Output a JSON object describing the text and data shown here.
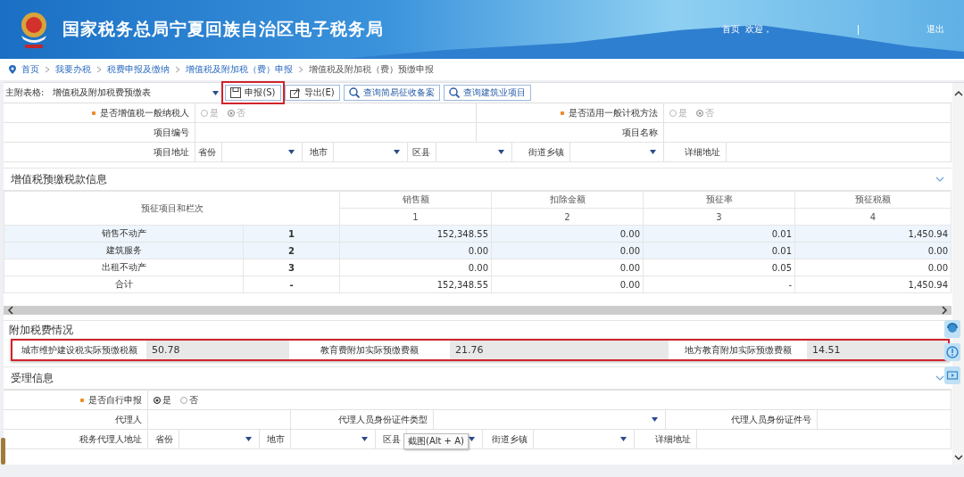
{
  "header": {
    "title": "国家税务总局宁夏回族自治区电子税务局",
    "home": "首页",
    "greeting": "欢迎，",
    "logout": "退出"
  },
  "breadcrumb": [
    {
      "label": "首页",
      "current": false
    },
    {
      "label": "我要办税",
      "current": false
    },
    {
      "label": "税费申报及缴纳",
      "current": false
    },
    {
      "label": "增值税及附加税（费）申报",
      "current": false
    },
    {
      "label": "增值税及附加税（费）预缴申报",
      "current": true
    }
  ],
  "toolbar": {
    "label": "主附表格:",
    "table_select": "增值税及附加税费预缴表",
    "buttons": [
      {
        "label": "申报(S)",
        "kind": "submit",
        "highlighted": true
      },
      {
        "label": "导出(E)",
        "kind": "export",
        "highlighted": false
      },
      {
        "label": "查询简易征收备案",
        "kind": "query",
        "highlighted": false
      },
      {
        "label": "查询建筑业项目",
        "kind": "query",
        "highlighted": false
      }
    ]
  },
  "project_form": {
    "taxpayer_row": {
      "kind": "pair",
      "cells": [
        {
          "kind": "label",
          "text": "是否增值税一般纳税人",
          "required": true
        },
        {
          "kind": "radio",
          "disabled": true,
          "options": [
            {
              "label": "是",
              "selected": false
            },
            {
              "label": "否",
              "selected": true
            }
          ]
        },
        {
          "kind": "label",
          "text": "是否适用一般计税方法",
          "required": true
        },
        {
          "kind": "radio",
          "disabled": true,
          "options": [
            {
              "label": "是",
              "selected": false
            },
            {
              "label": "否",
              "selected": true
            }
          ]
        }
      ]
    },
    "project_row": {
      "kind": "pair",
      "cells": [
        {
          "kind": "label",
          "text": "项目编号",
          "required": false
        },
        {
          "kind": "field"
        },
        {
          "kind": "label",
          "text": "项目名称",
          "required": false
        },
        {
          "kind": "field"
        }
      ]
    },
    "address_row": {
      "kind": "address",
      "cells": [
        {
          "kind": "label",
          "text": "项目地址",
          "required": false
        },
        {
          "kind": "label",
          "text": "省份",
          "required": false
        },
        {
          "kind": "select"
        },
        {
          "kind": "label",
          "text": "地市",
          "required": false
        },
        {
          "kind": "select"
        },
        {
          "kind": "label",
          "text": "区县",
          "required": false
        },
        {
          "kind": "select"
        },
        {
          "kind": "label",
          "text": "街道乡镇",
          "required": false
        },
        {
          "kind": "select"
        },
        {
          "kind": "label",
          "text": "详细地址",
          "required": false
        },
        {
          "kind": "field"
        }
      ]
    }
  },
  "prepayment": {
    "title": "增值税预缴税款信息",
    "item_header": "预征项目和栏次",
    "columns": [
      {
        "label": "销售额",
        "number": "1"
      },
      {
        "label": "扣除金额",
        "number": "2"
      },
      {
        "label": "预征率",
        "number": "3"
      },
      {
        "label": "预征税额",
        "number": "4"
      }
    ],
    "rows": [
      {
        "item": "销售不动产",
        "line": "1",
        "values": [
          "152,348.55",
          "0.00",
          "0.01",
          "1,450.94"
        ],
        "highlighted": true
      },
      {
        "item": "建筑服务",
        "line": "2",
        "values": [
          "0.00",
          "0.00",
          "0.01",
          "0.00"
        ],
        "highlighted": true
      },
      {
        "item": "出租不动产",
        "line": "3",
        "values": [
          "0.00",
          "0.00",
          "0.05",
          "0.00"
        ],
        "highlighted": false
      },
      {
        "item": "合计",
        "line": "-",
        "values": [
          "152,348.55",
          "0.00",
          "-",
          "1,450.94"
        ],
        "highlighted": false
      }
    ]
  },
  "surcharge": {
    "title": "附加税费情况",
    "highlighted": true,
    "fields": [
      {
        "label": "城市维护建设税实际预缴税额",
        "value": "50.78"
      },
      {
        "label": "教育费附加实际预缴费额",
        "value": "21.76"
      },
      {
        "label": "地方教育附加实际预缴费额",
        "value": "14.51"
      }
    ]
  },
  "acceptance": {
    "title": "受理信息",
    "form": {
      "self_filing_row": {
        "kind": "single",
        "cells": [
          {
            "kind": "label",
            "text": "是否自行申报",
            "required": true
          },
          {
            "kind": "radio",
            "disabled": false,
            "options": [
              {
                "label": "是",
                "selected": true
              },
              {
                "label": "否",
                "selected": false
              }
            ]
          }
        ]
      },
      "agent_row": {
        "kind": "agent",
        "cells": [
          {
            "kind": "label",
            "text": "代理人",
            "required": false
          },
          {
            "kind": "field"
          },
          {
            "kind": "label",
            "text": "代理人员身份证件类型",
            "required": false
          },
          {
            "kind": "select"
          },
          {
            "kind": "label",
            "text": "代理人员身份证件号",
            "required": false
          },
          {
            "kind": "field"
          }
        ]
      },
      "address_row": {
        "kind": "address",
        "cells": [
          {
            "kind": "label",
            "text": "税务代理人地址",
            "required": false
          },
          {
            "kind": "label",
            "text": "省份",
            "required": false
          },
          {
            "kind": "select"
          },
          {
            "kind": "label",
            "text": "地市",
            "required": false
          },
          {
            "kind": "select"
          },
          {
            "kind": "label",
            "text": "区县",
            "required": false
          },
          {
            "kind": "select"
          },
          {
            "kind": "label",
            "text": "街道乡镇",
            "required": false
          },
          {
            "kind": "select"
          },
          {
            "kind": "label",
            "text": "详细地址",
            "required": false
          },
          {
            "kind": "field"
          }
        ]
      }
    }
  },
  "tooltip": "截图(Alt + A)"
}
